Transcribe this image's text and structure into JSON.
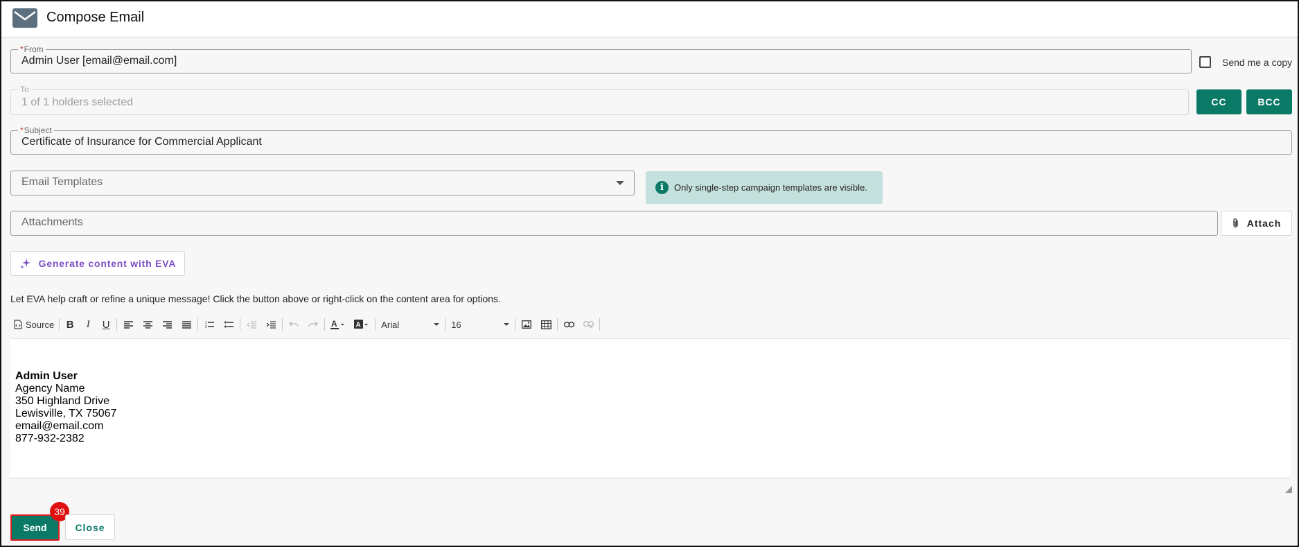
{
  "header": {
    "title": "Compose Email",
    "icon": "mail-icon"
  },
  "from": {
    "label": "From",
    "value": "Admin User [email@email.com]",
    "required": true
  },
  "send_copy": {
    "label": "Send me a copy",
    "checked": false
  },
  "to": {
    "label": "To",
    "value": "1 of 1 holders selected"
  },
  "cc_label": "CC",
  "bcc_label": "BCC",
  "subject": {
    "label": "Subject",
    "value": "Certificate of Insurance for Commercial Applicant",
    "required": true
  },
  "templates": {
    "placeholder": "Email Templates"
  },
  "info": {
    "icon": "info-icon",
    "text": "Only single-step campaign templates are visible."
  },
  "attachments": {
    "placeholder": "Attachments",
    "attach_label": "Attach"
  },
  "eva": {
    "button_label": "Generate content with EVA",
    "helper_text": "Let EVA help craft or refine a unique message! Click the button above or right-click on the content area for options."
  },
  "toolbar": {
    "source_label": "Source",
    "font_family": "Arial",
    "font_size": "16"
  },
  "signature": {
    "name": "Admin User",
    "agency": "Agency Name",
    "address1": "350 Highland Drive",
    "address2": "Lewisville, TX 75067",
    "email": "email@email.com",
    "phone": "877-932-2382"
  },
  "footer": {
    "send_label": "Send",
    "close_label": "Close",
    "badge": "39"
  },
  "colors": {
    "accent": "#0a7a66",
    "info_bg": "#c4e1dd",
    "eva_purple": "#7b4fc4",
    "badge_red": "#e01010"
  }
}
